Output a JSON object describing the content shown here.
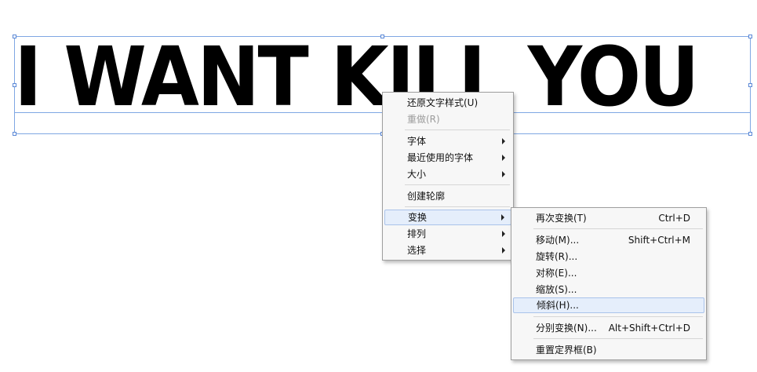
{
  "canvas": {
    "text": "I WANT KILL YOU"
  },
  "context_menu": {
    "items": [
      {
        "label": "还原文字样式(U)"
      },
      {
        "label": "重做(R)"
      },
      {
        "label": "字体"
      },
      {
        "label": "最近使用的字体"
      },
      {
        "label": "大小"
      },
      {
        "label": "创建轮廓"
      },
      {
        "label": "变换"
      },
      {
        "label": "排列"
      },
      {
        "label": "选择"
      }
    ]
  },
  "submenu": {
    "items": [
      {
        "label": "再次变换(T)",
        "shortcut": "Ctrl+D"
      },
      {
        "label": "移动(M)...",
        "shortcut": "Shift+Ctrl+M"
      },
      {
        "label": "旋转(R)..."
      },
      {
        "label": "对称(E)..."
      },
      {
        "label": "缩放(S)..."
      },
      {
        "label": "倾斜(H)..."
      },
      {
        "label": "分别变换(N)...",
        "shortcut": "Alt+Shift+Ctrl+D"
      },
      {
        "label": "重置定界框(B)"
      }
    ]
  }
}
